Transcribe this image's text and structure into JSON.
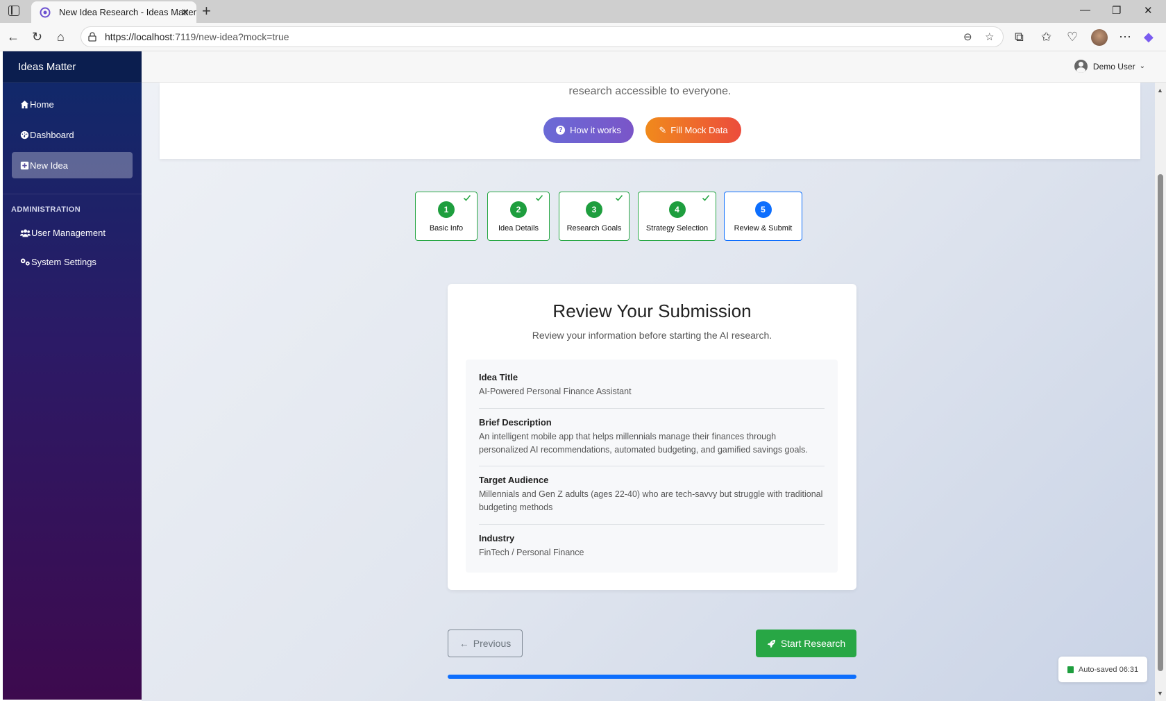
{
  "browser": {
    "tab_title": "New Idea Research - Ideas Matter",
    "url_host": "https://localhost",
    "url_rest": ":7119/new-idea?mock=true"
  },
  "sidebar": {
    "brand": "Ideas Matter",
    "items": [
      {
        "label": "Home",
        "icon": "home-icon"
      },
      {
        "label": "Dashboard",
        "icon": "dashboard-icon"
      },
      {
        "label": "New Idea",
        "icon": "plus-square-icon",
        "active": true
      }
    ],
    "section_heading": "ADMINISTRATION",
    "admin_items": [
      {
        "label": "User Management",
        "icon": "users-icon"
      },
      {
        "label": "System Settings",
        "icon": "gears-icon"
      }
    ]
  },
  "topbar": {
    "user_name": "Demo User"
  },
  "hero": {
    "text": "research accessible to everyone.",
    "how_label": "How it works",
    "mock_label": "Fill Mock Data"
  },
  "steps": [
    {
      "num": "1",
      "label": "Basic Info",
      "status": "complete"
    },
    {
      "num": "2",
      "label": "Idea Details",
      "status": "complete"
    },
    {
      "num": "3",
      "label": "Research Goals",
      "status": "complete"
    },
    {
      "num": "4",
      "label": "Strategy Selection",
      "status": "complete"
    },
    {
      "num": "5",
      "label": "Review & Submit",
      "status": "current"
    }
  ],
  "review": {
    "title": "Review Your Submission",
    "subtitle": "Review your information before starting the AI research.",
    "fields": [
      {
        "label": "Idea Title",
        "value": "AI-Powered Personal Finance Assistant"
      },
      {
        "label": "Brief Description",
        "value": "An intelligent mobile app that helps millennials manage their finances through personalized AI recommendations, automated budgeting, and gamified savings goals."
      },
      {
        "label": "Target Audience",
        "value": "Millennials and Gen Z adults (ages 22-40) who are tech-savvy but struggle with traditional budgeting methods"
      },
      {
        "label": "Industry",
        "value": "FinTech / Personal Finance"
      }
    ]
  },
  "actions": {
    "previous_label": "Previous",
    "start_label": "Start Research"
  },
  "progress": {
    "fraction": 1.0
  },
  "autosave": {
    "text": "Auto-saved 06:31"
  },
  "colors": {
    "success": "#28a745",
    "primary": "#0d6efd",
    "sidebar_top": "#0e2a6a",
    "sidebar_bottom": "#3d0a4e"
  }
}
